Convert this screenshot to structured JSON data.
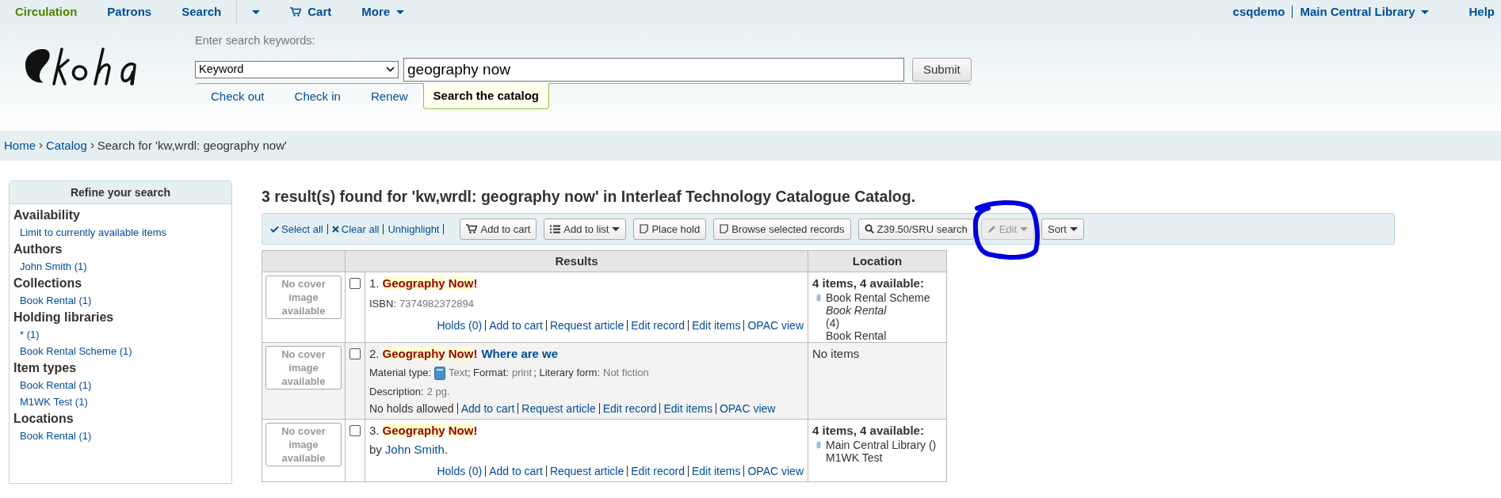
{
  "nav": {
    "left": [
      {
        "label": "Circulation",
        "kind": "link",
        "selected": true
      },
      {
        "label": "Patrons",
        "kind": "link",
        "selected": false
      },
      {
        "label": "Search",
        "kind": "link",
        "selected": false
      },
      {
        "kind": "caret",
        "selected": false
      },
      {
        "label": "Cart",
        "kind": "cart",
        "selected": false
      },
      {
        "label": "More",
        "kind": "menu",
        "selected": false
      }
    ],
    "user": "csqdemo",
    "library": "Main Central Library",
    "help": "Help"
  },
  "search": {
    "label": "Enter search keywords:",
    "type": "Keyword",
    "value": "geography now",
    "submit": "Submit",
    "tabs": [
      {
        "label": "Check out",
        "selected": false
      },
      {
        "label": "Check in",
        "selected": false
      },
      {
        "label": "Renew",
        "selected": false
      },
      {
        "label": "Search the catalog",
        "selected": true
      }
    ]
  },
  "breadcrumbs": [
    {
      "label": "Home",
      "kind": "link"
    },
    {
      "label": "Catalog",
      "kind": "link"
    },
    {
      "label": "Search for 'kw,wrdl: geography now'",
      "kind": "current"
    }
  ],
  "sidebar": {
    "title": "Refine your search",
    "groups": [
      {
        "heading": "Availability",
        "items": [
          "Limit to currently available items"
        ]
      },
      {
        "heading": "Authors",
        "items": [
          "John Smith (1)"
        ]
      },
      {
        "heading": "Collections",
        "items": [
          "Book Rental (1)"
        ]
      },
      {
        "heading": "Holding libraries",
        "items": [
          "* (1)",
          "Book Rental Scheme (1)"
        ]
      },
      {
        "heading": "Item types",
        "items": [
          "Book Rental (1)",
          "M1WK Test (1)"
        ]
      },
      {
        "heading": "Locations",
        "items": [
          "Book Rental (1)"
        ]
      }
    ]
  },
  "heading": "3 result(s) found for 'kw,wrdl: geography now' in Interleaf Technology Catalogue Catalog.",
  "toolbar": {
    "links": [
      {
        "label": "Select all",
        "kind": "check"
      },
      {
        "label": "Clear all",
        "kind": "cross"
      },
      {
        "label": "Unhighlight",
        "kind": "plain"
      }
    ],
    "buttons": [
      {
        "label": "Add to cart",
        "kind": "cart",
        "dropdown": false,
        "disabled": false
      },
      {
        "label": "Add to list",
        "kind": "list",
        "dropdown": true,
        "disabled": false
      },
      {
        "label": "Place hold",
        "kind": "note",
        "dropdown": false,
        "disabled": false
      },
      {
        "label": "Browse selected records",
        "kind": "note",
        "dropdown": false,
        "disabled": false
      },
      {
        "label": "Z39.50/SRU search",
        "kind": "search",
        "dropdown": false,
        "disabled": false
      },
      {
        "label": "Edit",
        "kind": "pencil",
        "dropdown": true,
        "disabled": true
      },
      {
        "label": "Sort",
        "kind": "plain",
        "dropdown": true,
        "disabled": false
      }
    ]
  },
  "table": {
    "columns": [
      "Results",
      "Location"
    ],
    "rows": [
      {
        "cover": "No cover image available",
        "checked": false,
        "number": "1.",
        "title": [
          {
            "text": "Geography",
            "kind": "match"
          },
          {
            "text": "Now",
            "kind": "match"
          },
          {
            "text": "!",
            "kind": "punct"
          }
        ],
        "details": [
          {
            "kind": "field",
            "label": "ISBN:",
            "value": "7374982372894"
          }
        ],
        "actions": [
          {
            "label": "Holds (0)",
            "kind": "link"
          },
          {
            "label": "Add to cart",
            "kind": "link"
          },
          {
            "label": "Request article",
            "kind": "link"
          },
          {
            "label": "Edit record",
            "kind": "link"
          },
          {
            "label": "Edit items",
            "kind": "link"
          },
          {
            "label": "OPAC view",
            "kind": "link"
          }
        ],
        "location": {
          "kind": "items",
          "summary": "4 items, 4 available:",
          "lines": [
            {
              "text": "Book Rental Scheme",
              "italic": false
            },
            {
              "text": "Book Rental",
              "italic": true
            },
            {
              "text": "(4)",
              "italic": false
            },
            {
              "text": "Book Rental",
              "italic": false
            }
          ]
        }
      },
      {
        "cover": "No cover image available",
        "checked": false,
        "number": "2.",
        "title": [
          {
            "text": "Geography",
            "kind": "match"
          },
          {
            "text": "Now",
            "kind": "match"
          },
          {
            "text": "!",
            "kind": "punct"
          },
          {
            "text": "Where are we",
            "kind": "phrase"
          }
        ],
        "details": [
          {
            "kind": "material",
            "label": "Material type:",
            "value": "Text"
          },
          {
            "kind": "inline",
            "label": "; Format:",
            "value": "print"
          },
          {
            "kind": "inline",
            "label": "; Literary form:",
            "value": "Not fiction"
          },
          {
            "kind": "field",
            "label": "Description:",
            "value": "2 pg."
          }
        ],
        "actions": [
          {
            "label": "No holds allowed",
            "kind": "text"
          },
          {
            "label": "Add to cart",
            "kind": "link"
          },
          {
            "label": "Request article",
            "kind": "link"
          },
          {
            "label": "Edit record",
            "kind": "link"
          },
          {
            "label": "Edit items",
            "kind": "link"
          },
          {
            "label": "OPAC view",
            "kind": "link"
          }
        ],
        "location": {
          "kind": "none",
          "summary": "No items"
        }
      },
      {
        "cover": "No cover image available",
        "checked": false,
        "number": "3.",
        "title": [
          {
            "text": "Geography",
            "kind": "match"
          },
          {
            "text": "Now",
            "kind": "match"
          },
          {
            "text": "!",
            "kind": "punct"
          }
        ],
        "details": [
          {
            "kind": "author",
            "label": "by",
            "value": "John Smith",
            "suffix": "."
          }
        ],
        "actions": [
          {
            "label": "Holds (0)",
            "kind": "link"
          },
          {
            "label": "Add to cart",
            "kind": "link"
          },
          {
            "label": "Request article",
            "kind": "link"
          },
          {
            "label": "Edit record",
            "kind": "link"
          },
          {
            "label": "Edit items",
            "kind": "link"
          },
          {
            "label": "OPAC view",
            "kind": "link"
          }
        ],
        "location": {
          "kind": "items",
          "summary": "4 items, 4 available:",
          "lines": [
            {
              "text": "Main Central Library ()",
              "italic": false
            },
            {
              "text": "M1WK Test",
              "italic": false
            }
          ]
        }
      }
    ]
  }
}
